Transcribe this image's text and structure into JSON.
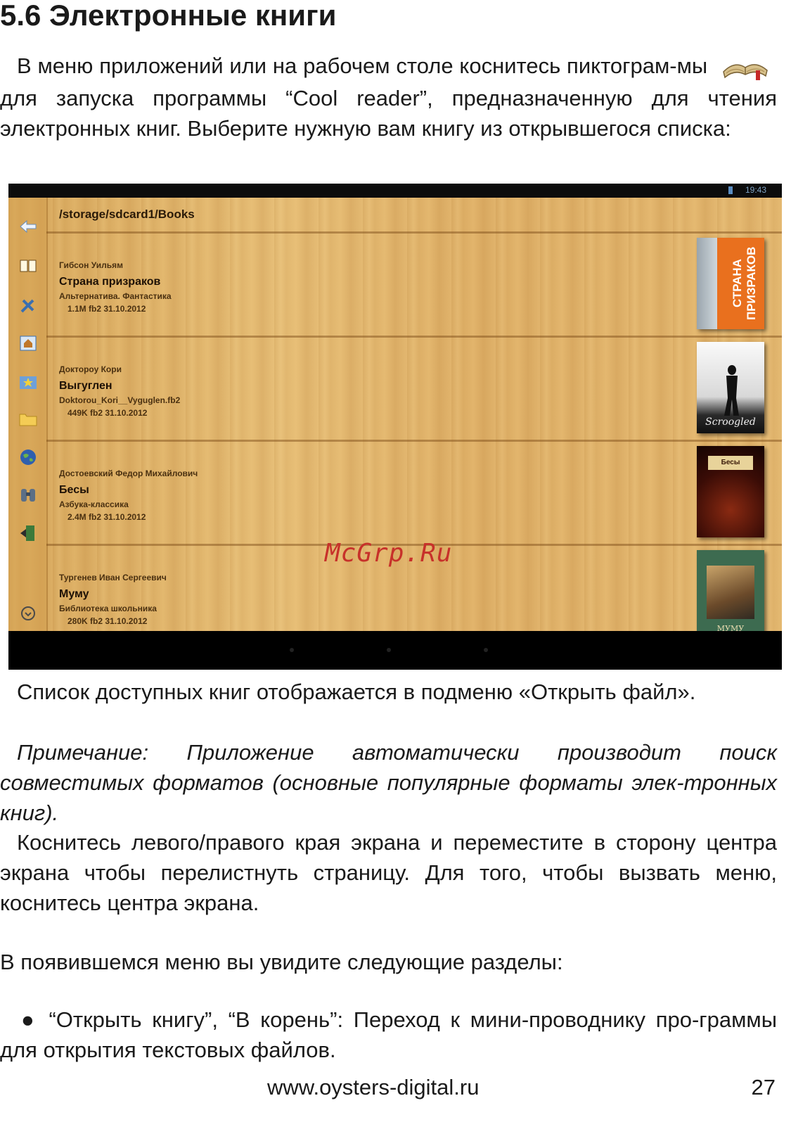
{
  "heading": "5.6 Электронные книги",
  "intro": {
    "part1": "В меню приложений или на рабочем столе коснитесь пиктограм-мы",
    "icon": "cool-reader-book-icon",
    "part2": "для запуска программы “Cool reader”, предназначенную для чтения электронных книг. Выберите нужную вам книгу из открывшегося списка:"
  },
  "screenshot": {
    "clock": "19:43",
    "path": "/storage/sdcard1/Books",
    "sidebar_icons": [
      "back-arrow-icon",
      "open-book-icon",
      "tools-icon",
      "home-icon",
      "favorites-star-icon",
      "folder-icon",
      "globe-icon",
      "binoculars-search-icon",
      "exit-icon",
      "menu-down-icon"
    ],
    "books": [
      {
        "author": "Гибсон Уильям",
        "title": "Страна призраков",
        "series": "Альтернатива. Фантастика",
        "meta": "1.1M fb2 31.10.2012",
        "cover_text": "СТРАНА ПРИЗРАКОВ"
      },
      {
        "author": "Доктороу Кори",
        "title": "Выгуглен",
        "series": "Doktorou_Kori__Vyguglen.fb2",
        "meta": "449K fb2 31.10.2012",
        "cover_text": "Scroogled"
      },
      {
        "author": "Достоевский Федор Михайлович",
        "title": "Бесы",
        "series": "Азбука-классика",
        "meta": "2.4M fb2 31.10.2012",
        "cover_text": "Бесы"
      },
      {
        "author": "Тургенев Иван Сергеевич",
        "title": "Муму",
        "series": "Библиотека школьника",
        "meta": "280K fb2 31.10.2012",
        "cover_text": "МУМУ"
      }
    ],
    "colors": {
      "wood": "#e0b46c",
      "shelf_line": "#8a5a22",
      "status": "#0c0c0c"
    }
  },
  "watermark": "McGrp.Ru",
  "para_list": "Список доступных книг отображается в подменю «Открыть файл».",
  "para_note": "Примечание: Приложение автоматически производит поиск совместимых форматов (основные популярные форматы элек-тронных книг).",
  "para_swipe": "Коснитесь левого/правого края экрана и переместите в сторону центра экрана чтобы перелистнуть страницу. Для того, чтобы вызвать меню, коснитесь центра экрана.",
  "para_menu": "В появившемся меню вы увидите следующие разделы:",
  "bullet_open": "● “Открыть книгу”, “В корень”: Переход к мини-проводнику про-граммы для открытия текстовых файлов.",
  "footer": {
    "url": "www.oysters-digital.ru",
    "page": "27"
  }
}
